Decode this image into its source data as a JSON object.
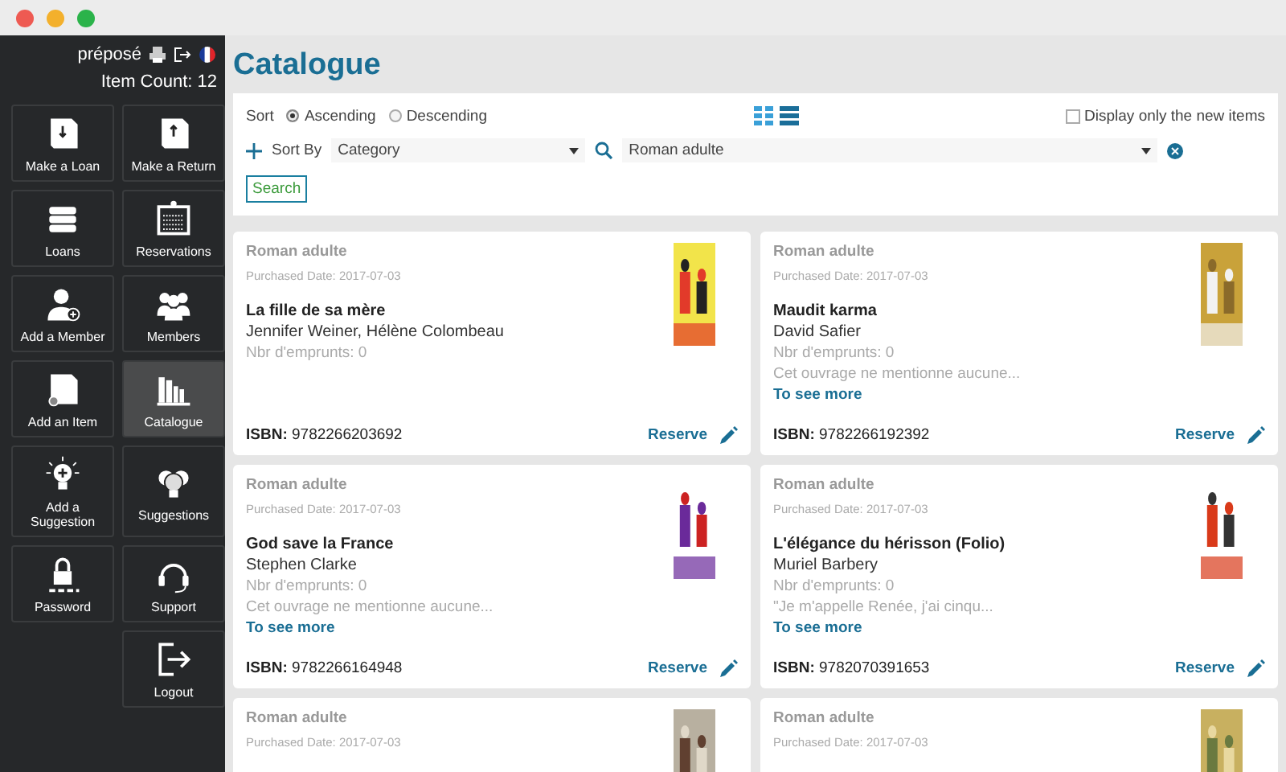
{
  "header": {
    "user": "préposé",
    "item_count": "Item Count: 12"
  },
  "menu": [
    {
      "label": "Make a Loan",
      "selected": false
    },
    {
      "label": "Make a Return",
      "selected": false
    },
    {
      "label": "Loans",
      "selected": false
    },
    {
      "label": "Reservations",
      "selected": false
    },
    {
      "label": "Add a Member",
      "selected": false
    },
    {
      "label": "Members",
      "selected": false
    },
    {
      "label": "Add an Item",
      "selected": false
    },
    {
      "label": "Catalogue",
      "selected": true
    },
    {
      "label": "Add a Suggestion",
      "selected": false
    },
    {
      "label": "Suggestions",
      "selected": false
    },
    {
      "label": "Password",
      "selected": false
    },
    {
      "label": "Support",
      "selected": false
    },
    {
      "label": "Logout",
      "selected": false
    }
  ],
  "page_title": "Catalogue",
  "filters": {
    "sort_label": "Sort",
    "sort_options": [
      {
        "label": "Ascending",
        "selected": true
      },
      {
        "label": "Descending",
        "selected": false
      }
    ],
    "view_modes": [
      {
        "kind": "grid",
        "selected": true
      },
      {
        "kind": "list",
        "selected": false
      }
    ],
    "new_only": {
      "label": "Display only the new items",
      "checked": false
    },
    "sort_by_label": "Sort By",
    "sort_by_value": "Category",
    "search_value": "Roman adulte",
    "search_button": "Search"
  },
  "books": [
    {
      "category": "Roman adulte",
      "purchased": "Purchased Date: 2017-07-03",
      "title": "La fille de sa mère",
      "author": "Jennifer Weiner, Hélène Colombeau",
      "loans": "Nbr d'emprunts: 0",
      "isbn": "**ISBN:** 9782266203692",
      "reserve": "Reserve"
    },
    {
      "category": "Roman adulte",
      "purchased": "Purchased Date: 2017-07-03",
      "title": "Maudit karma",
      "author": "David Safier",
      "loans": "Nbr d'emprunts: 0",
      "excerpt": "Cet ouvrage ne mentionne aucune...",
      "more": "To see more",
      "isbn": "**ISBN:** 9782266192392",
      "reserve": "Reserve"
    },
    {
      "category": "Roman adulte",
      "purchased": "Purchased Date: 2017-07-03",
      "title": "God save la France",
      "author": "Stephen Clarke",
      "loans": "Nbr d'emprunts: 0",
      "excerpt": "Cet ouvrage ne mentionne aucune...",
      "more": "To see more",
      "isbn": "**ISBN:** 9782266164948",
      "reserve": "Reserve"
    },
    {
      "category": "Roman adulte",
      "purchased": "Purchased Date: 2017-07-03",
      "title": "L'élégance du hérisson (Folio)",
      "author": "Muriel Barbery",
      "loans": "Nbr d'emprunts: 0",
      "excerpt": "\"Je m'appelle Renée, j'ai cinqu...",
      "more": "To see more",
      "isbn": "**ISBN:** 9782070391653",
      "reserve": "Reserve"
    },
    {
      "category": "Roman adulte",
      "purchased": "Purchased Date: 2017-07-03"
    },
    {
      "category": "Roman adulte",
      "purchased": "Purchased Date: 2017-07-03"
    }
  ]
}
